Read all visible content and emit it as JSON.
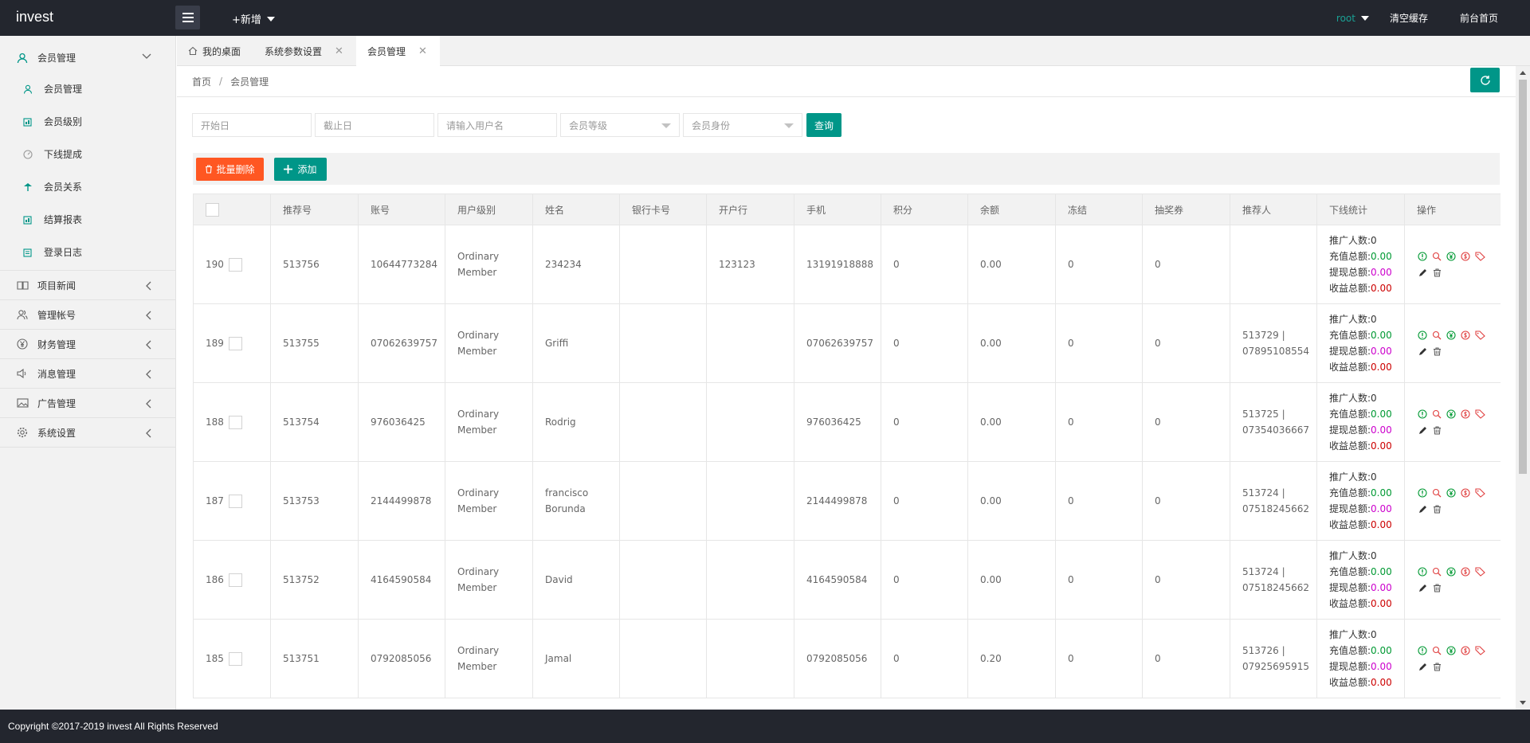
{
  "app": {
    "logo": "invest",
    "add_new": "+新增",
    "user": "root",
    "clear_cache": "清空缓存",
    "front_home": "前台首页"
  },
  "sidebar": {
    "group_member": "会员管理",
    "sub_items": [
      {
        "label": "会员管理",
        "icon": "user-icon"
      },
      {
        "label": "会员级别",
        "icon": "level-icon"
      },
      {
        "label": "下线提成",
        "icon": "gauge-icon"
      },
      {
        "label": "会员关系",
        "icon": "tree-icon"
      },
      {
        "label": "结算报表",
        "icon": "report-icon"
      },
      {
        "label": "登录日志",
        "icon": "log-icon"
      }
    ],
    "groups": [
      {
        "label": "项目新闻",
        "icon": "news-icon"
      },
      {
        "label": "管理帐号",
        "icon": "users-icon"
      },
      {
        "label": "财务管理",
        "icon": "yen-icon"
      },
      {
        "label": "消息管理",
        "icon": "speaker-icon"
      },
      {
        "label": "广告管理",
        "icon": "image-icon"
      },
      {
        "label": "系统设置",
        "icon": "gear-icon"
      }
    ]
  },
  "tabs": [
    {
      "label": "我的桌面"
    },
    {
      "label": "系统参数设置"
    },
    {
      "label": "会员管理"
    }
  ],
  "breadcrumb": {
    "home": "首页",
    "sep": "/",
    "current": "会员管理"
  },
  "search": {
    "start_date": "开始日",
    "end_date": "截止日",
    "username": "请输入用户名",
    "level": "会员等级",
    "identity": "会员身份",
    "query": "查询"
  },
  "toolbar": {
    "batch_delete": "批量删除",
    "add": "添加"
  },
  "table": {
    "headers": [
      "",
      "推荐号",
      "账号",
      "用户级别",
      "姓名",
      "银行卡号",
      "开户行",
      "手机",
      "积分",
      "余额",
      "冻结",
      "抽奖券",
      "推荐人",
      "下线统计",
      "操作"
    ],
    "stat_labels": {
      "promoters": "推广人数:",
      "recharge": "充值总额:",
      "withdraw": "提现总额:",
      "income": "收益总额:"
    },
    "rows": [
      {
        "id": "190",
        "ref": "513756",
        "account": "10644773284",
        "level": "Ordinary Member",
        "name": "234234",
        "card": "",
        "bank": "123123",
        "phone": "13191918888",
        "points": "0",
        "balance": "0.00",
        "frozen": "0",
        "tickets": "0",
        "referrer": "",
        "promoters": "0",
        "recharge": "0.00",
        "withdraw": "0.00",
        "income": "0.00"
      },
      {
        "id": "189",
        "ref": "513755",
        "account": "07062639757",
        "level": "Ordinary Member",
        "name": "Griffi",
        "card": "",
        "bank": "",
        "phone": "07062639757",
        "points": "0",
        "balance": "0.00",
        "frozen": "0",
        "tickets": "0",
        "referrer": "513729 | 07895108554",
        "promoters": "0",
        "recharge": "0.00",
        "withdraw": "0.00",
        "income": "0.00"
      },
      {
        "id": "188",
        "ref": "513754",
        "account": "976036425",
        "level": "Ordinary Member",
        "name": "Rodrig",
        "card": "",
        "bank": "",
        "phone": "976036425",
        "points": "0",
        "balance": "0.00",
        "frozen": "0",
        "tickets": "0",
        "referrer": "513725 | 07354036667",
        "promoters": "0",
        "recharge": "0.00",
        "withdraw": "0.00",
        "income": "0.00"
      },
      {
        "id": "187",
        "ref": "513753",
        "account": "2144499878",
        "level": "Ordinary Member",
        "name": "francisco Borunda",
        "card": "",
        "bank": "",
        "phone": "2144499878",
        "points": "0",
        "balance": "0.00",
        "frozen": "0",
        "tickets": "0",
        "referrer": "513724 | 07518245662",
        "promoters": "0",
        "recharge": "0.00",
        "withdraw": "0.00",
        "income": "0.00"
      },
      {
        "id": "186",
        "ref": "513752",
        "account": "4164590584",
        "level": "Ordinary Member",
        "name": "David",
        "card": "",
        "bank": "",
        "phone": "4164590584",
        "points": "0",
        "balance": "0.00",
        "frozen": "0",
        "tickets": "0",
        "referrer": "513724 | 07518245662",
        "promoters": "0",
        "recharge": "0.00",
        "withdraw": "0.00",
        "income": "0.00"
      },
      {
        "id": "185",
        "ref": "513751",
        "account": "0792085056",
        "level": "Ordinary Member",
        "name": "Jamal",
        "card": "",
        "bank": "",
        "phone": "0792085056",
        "points": "0",
        "balance": "0.20",
        "frozen": "0",
        "tickets": "0",
        "referrer": "513726 | 07925695915",
        "promoters": "0",
        "recharge": "0.00",
        "withdraw": "0.00",
        "income": "0.00"
      }
    ]
  },
  "footer": {
    "copyright": "Copyright ©2017-2019 invest All Rights Reserved"
  },
  "colors": {
    "teal": "#009688",
    "orange": "#ff5722",
    "dark": "#23262e",
    "green_value": "#009933",
    "magenta_value": "#cc00cc",
    "red_value": "#cc0000"
  }
}
